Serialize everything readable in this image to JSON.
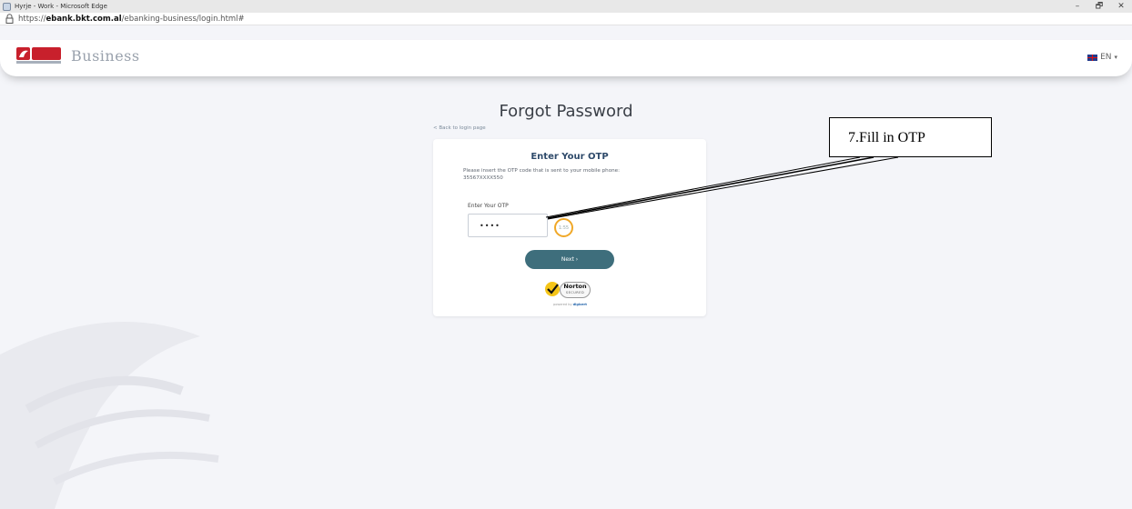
{
  "window": {
    "title": "Hyrje - Work - Microsoft Edge",
    "controls": {
      "minimize": "–",
      "restore": "🗗",
      "close": "✕"
    }
  },
  "address_bar": {
    "url_prefix": "https://",
    "url_domain": "ebank.bkt.com.al",
    "url_path": "/ebanking-business/login.html#"
  },
  "header": {
    "logo_text": "BKT",
    "brand": "Business",
    "language": "EN"
  },
  "page": {
    "title": "Forgot Password",
    "back_link": "< Back to login page"
  },
  "otp_card": {
    "title": "Enter Your OTP",
    "description_line1": "Please insert the OTP code that is sent to your mobile phone:",
    "description_line2": "35567XXXX550",
    "field_label": "Enter Your OTP",
    "field_value": "••••",
    "timer": "1:55",
    "next_button": "Next ›"
  },
  "norton_badge": {
    "name": "Norton",
    "secured": "SECURED",
    "powered_by": "powered by",
    "provider": "digicert"
  },
  "annotation": {
    "text": "7.Fill in OTP"
  },
  "colors": {
    "page_background": "#f4f5f9",
    "card_title": "#2e4a6a",
    "button": "#3e6e7c",
    "timer_ring": "#f0a828",
    "logo_red": "#c8202c"
  }
}
